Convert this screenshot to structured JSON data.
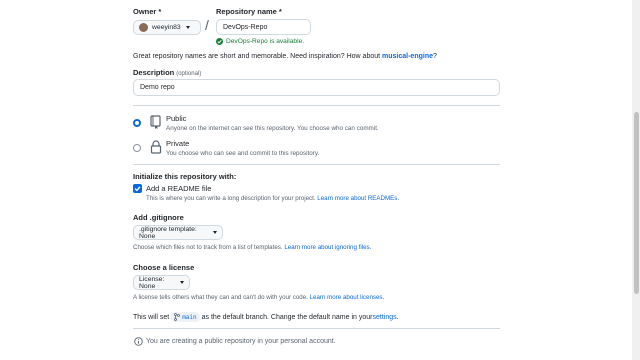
{
  "owner": {
    "label": "Owner *",
    "value": "weeyin83"
  },
  "repo": {
    "label": "Repository name *",
    "value": "DevOps-Repo",
    "availability": "DevOps-Repo is available."
  },
  "slash": "/",
  "hint": {
    "text": "Great repository names are short and memorable. Need inspiration? How about ",
    "suggestion": "musical-engine",
    "end": "?"
  },
  "description": {
    "label": "Description",
    "optional": "(optional)",
    "value": "Demo repo"
  },
  "visibility": {
    "public": {
      "title": "Public",
      "desc": "Anyone on the internet can see this repository. You choose who can commit.",
      "selected": true
    },
    "private": {
      "title": "Private",
      "desc": "You choose who can see and commit to this repository.",
      "selected": false
    }
  },
  "init": {
    "heading": "Initialize this repository with:",
    "readme_label": "Add a README file",
    "readme_desc": "This is where you can write a long description for your project. ",
    "readme_link": "Learn more about READMEs.",
    "readme_checked": true
  },
  "gitignore": {
    "heading": "Add .gitignore",
    "dropdown": ".gitignore template: None",
    "desc": "Choose which files not to track from a list of templates. ",
    "link": "Learn more about ignoring files."
  },
  "license": {
    "heading": "Choose a license",
    "dropdown": "License: None",
    "desc": "A license tells others what they can and can't do with your code. ",
    "link": "Learn more about licenses."
  },
  "branch": {
    "prefix": "This will set ",
    "name": "main",
    "middle": " as the default branch. Change the default name in your ",
    "link": "settings",
    "end": "."
  },
  "notice": "You are creating a public repository in your personal account.",
  "colors": {
    "accent": "#0969da",
    "success": "#1a7f37",
    "border": "#d1d9e0"
  }
}
